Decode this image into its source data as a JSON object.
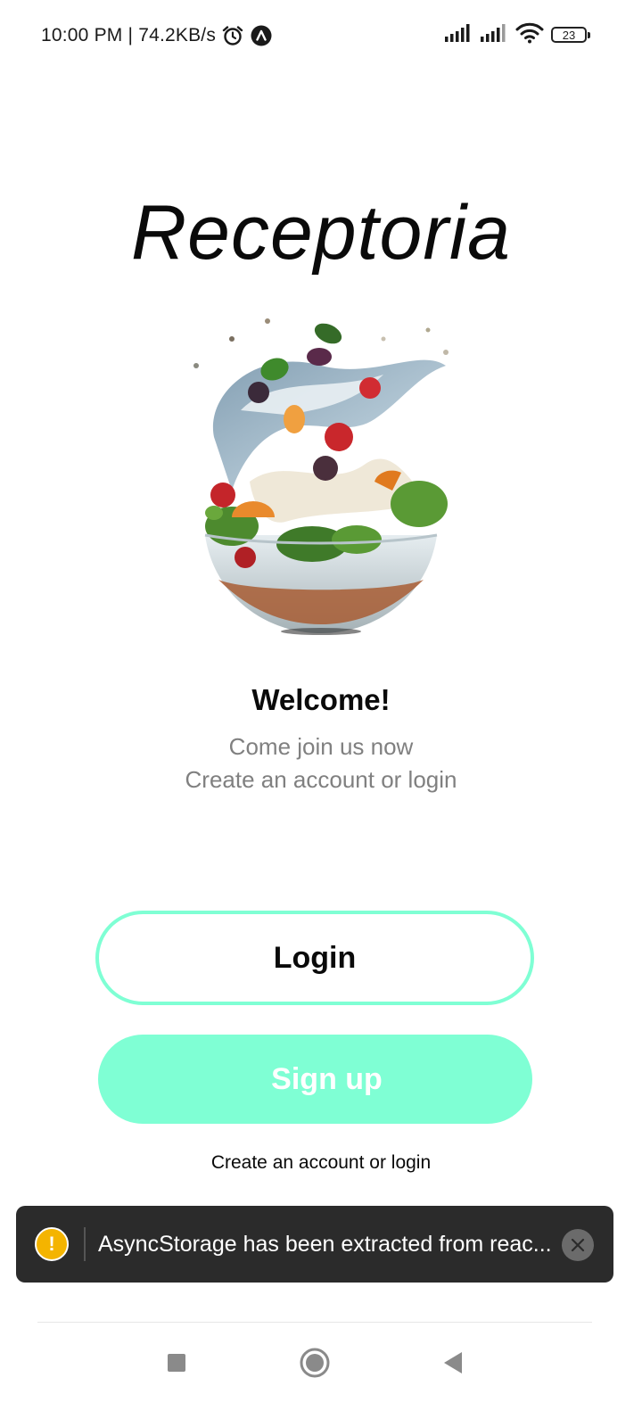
{
  "status_bar": {
    "time_and_speed": "10:00 PM | 74.2KB/s",
    "battery_level": "23",
    "icons": [
      "alarm-icon",
      "app-notification-icon",
      "signal-icon",
      "signal-icon",
      "wifi-icon",
      "battery-icon"
    ]
  },
  "app": {
    "title": "Receptoria",
    "hero_image": "salad-bowl-illustration"
  },
  "welcome": {
    "title": "Welcome!",
    "line1": "Come join us now",
    "line2": "Create an account or login"
  },
  "buttons": {
    "login_label": "Login",
    "signup_label": "Sign up"
  },
  "footer": {
    "text": "Create an account or login"
  },
  "toast": {
    "icon": "warning-icon",
    "message": "AsyncStorage has been extracted from reac...",
    "close_icon": "close-icon"
  },
  "navigation_bar": {
    "buttons": [
      "recents-icon",
      "home-icon",
      "back-icon"
    ]
  },
  "colors": {
    "accent": "#7fffd4",
    "text_primary": "#0a0a0a",
    "text_secondary": "#808080",
    "toast_bg": "#2b2b2b",
    "warning": "#f4b400"
  }
}
